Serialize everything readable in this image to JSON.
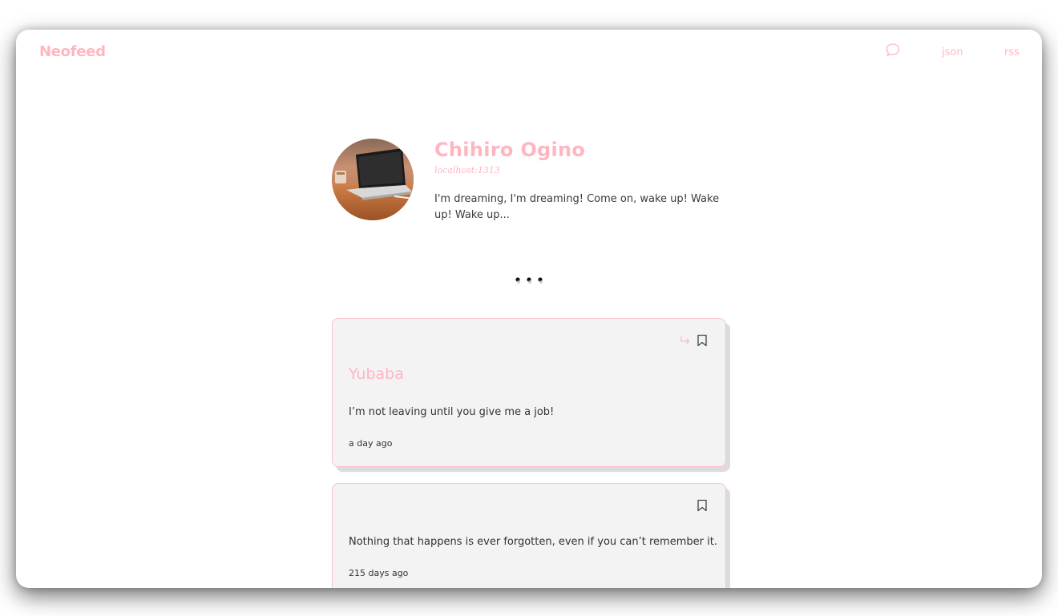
{
  "header": {
    "brand": "Neofeed",
    "nav": {
      "chat_icon": "chat-bubble-icon",
      "json_label": "json",
      "rss_label": "rss"
    }
  },
  "profile": {
    "name": "Chihiro Ogino",
    "host": "localhost:1313",
    "bio": "I'm dreaming, I'm dreaming! Come on, wake up! Wake up! Wake up..."
  },
  "loading_icon": "ellipsis-icon",
  "posts": [
    {
      "author": "Yubaba",
      "text": "I’m not leaving until you give me a job!",
      "time": "a day ago",
      "icons": [
        "reply-arrow-icon",
        "bookmark-icon"
      ]
    },
    {
      "author": "",
      "text": "Nothing that happens is ever forgotten, even if you can’t remember it.",
      "time": "215 days ago",
      "icons": [
        "bookmark-icon"
      ]
    }
  ],
  "colors": {
    "accent": "#ffb6c1",
    "card_bg": "#f3f3f3",
    "card_border": "#ffc0cb",
    "text": "#333333"
  }
}
